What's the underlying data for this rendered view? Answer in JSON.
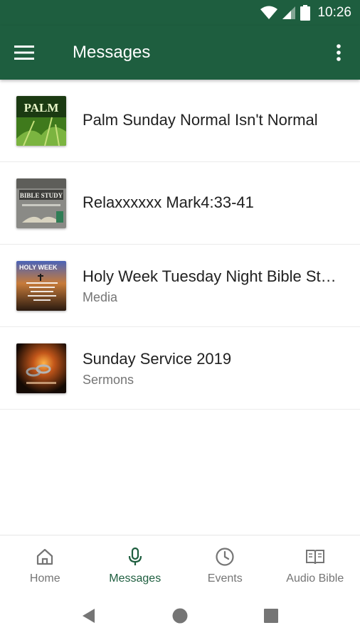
{
  "status_bar": {
    "time": "10:26",
    "icons": [
      "wifi-icon",
      "cellular-signal-icon",
      "battery-icon"
    ]
  },
  "app_bar": {
    "title": "Messages",
    "menu_icon": "hamburger-menu-icon",
    "overflow_icon": "more-vert-icon"
  },
  "messages": [
    {
      "title": "Palm Sunday Normal Isn't Normal",
      "subtitle": "",
      "thumbnail_text": "PALM"
    },
    {
      "title": "Relaxxxxxx  Mark4:33-41",
      "subtitle": "",
      "thumbnail_text": "BIBLE STUDY"
    },
    {
      "title": "Holy Week Tuesday Night Bible Study",
      "subtitle": "Media",
      "thumbnail_text": "HOLY WEEK"
    },
    {
      "title": "Sunday Service 2019",
      "subtitle": "Sermons",
      "thumbnail_text": ""
    }
  ],
  "bottom_nav": [
    {
      "label": "Home",
      "icon": "home-icon",
      "active": false
    },
    {
      "label": "Messages",
      "icon": "microphone-icon",
      "active": true
    },
    {
      "label": "Events",
      "icon": "clock-icon",
      "active": false
    },
    {
      "label": "Audio Bible",
      "icon": "open-book-icon",
      "active": false
    }
  ],
  "colors": {
    "primary": "#1e5e3f",
    "active_nav": "#1e5e3f",
    "inactive_nav": "#757575",
    "subtitle": "#757575"
  }
}
